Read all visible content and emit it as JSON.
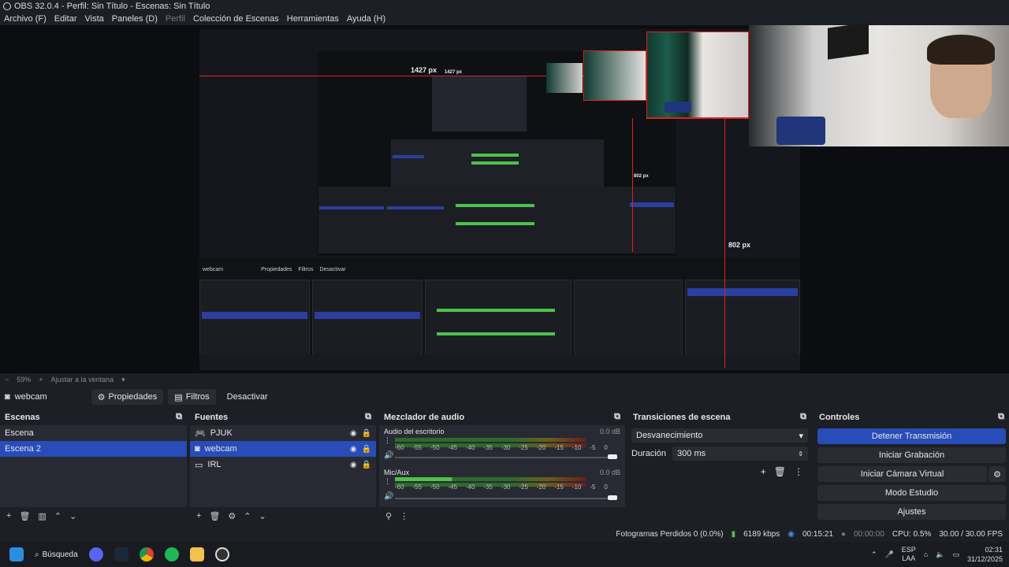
{
  "window": {
    "title": "OBS 32.0.4 - Perfil: Sin Título - Escenas: Sin Título"
  },
  "menu": [
    "Archivo (F)",
    "Editar",
    "Vista",
    "Paneles (D)",
    "Perfil",
    "Colección de Escenas",
    "Herramientas",
    "Ayuda (H)"
  ],
  "preview": {
    "measure_top": "1427 px",
    "measure_side": "802 px",
    "nested_measure_top": "1427 px",
    "nested_measure_side": "802 px",
    "nested_source_name": "webcam",
    "nested_buttons": [
      "Propiedades",
      "Filtros",
      "Desactivar"
    ]
  },
  "zoom": {
    "percent": "59%",
    "fit_label": "Ajustar a la ventana"
  },
  "source_toolbar": {
    "source_name": "webcam",
    "properties": "Propiedades",
    "filters": "Filtros",
    "deactivate": "Desactivar"
  },
  "scenes": {
    "title": "Escenas",
    "items": [
      "Escena",
      "Escena 2"
    ],
    "selected": 1
  },
  "sources": {
    "title": "Fuentes",
    "items": [
      "PJUK",
      "webcam",
      "IRL"
    ],
    "selected": 1
  },
  "mixer": {
    "title": "Mezclador de audio",
    "channels": [
      {
        "name": "Audio del escritorio",
        "db": "0.0 dB"
      },
      {
        "name": "Mic/Aux",
        "db": "0.0 dB"
      }
    ],
    "ticks": [
      "-60",
      "-55",
      "-50",
      "-45",
      "-40",
      "-35",
      "-30",
      "-25",
      "-20",
      "-15",
      "-10",
      "-5",
      "0"
    ]
  },
  "transitions": {
    "title": "Transiciones de escena",
    "selected": "Desvanecimiento",
    "duration_label": "Duración",
    "duration_value": "300 ms"
  },
  "controls": {
    "title": "Controles",
    "buttons": [
      "Detener Transmisión",
      "Iniciar Grabación",
      "Iniciar Cámara Virtual",
      "Modo Estudio",
      "Ajustes"
    ]
  },
  "status": {
    "dropped": "Fotogramas Perdidos 0 (0.0%)",
    "bitrate": "6189 kbps",
    "stream_time": "00:15:21",
    "rec_time": "00:00:00",
    "cpu": "CPU: 0.5%",
    "fps": "30.00 / 30.00 FPS"
  },
  "taskbar": {
    "search": "Búsqueda",
    "lang_top": "ESP",
    "lang_bottom": "LAA",
    "time": "02:31",
    "date": "31/12/2025"
  },
  "colors": {
    "accent": "#284cb8",
    "meter_green": "#4cc24c",
    "meter_yellow": "#c8b43a",
    "meter_red": "#c83a3a",
    "panel": "#272a33"
  }
}
